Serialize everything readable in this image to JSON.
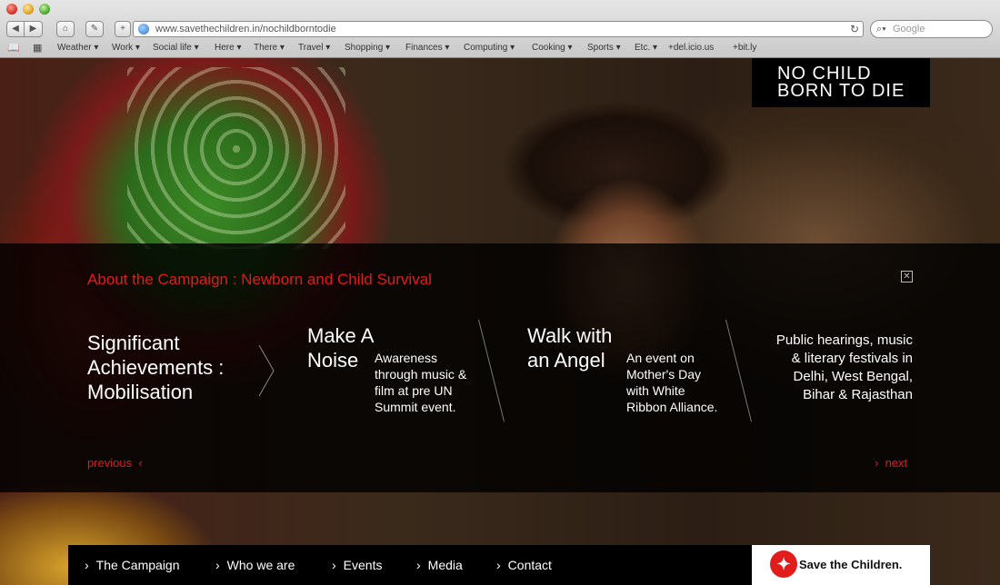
{
  "browser": {
    "url": "www.savethechildren.in/nochildborntodie",
    "search_placeholder": "Google",
    "bookmarks": [
      "Weather ▾",
      "Work ▾",
      "Social life ▾",
      "Here ▾",
      "There ▾",
      "Travel ▾",
      "Shopping ▾",
      "Finances ▾",
      "Computing ▾",
      "Cooking ▾",
      "Sports ▾",
      "Etc. ▾",
      "+del.icio.us",
      "+bit.ly"
    ]
  },
  "logo": {
    "line1": "NO CHILD",
    "line2": "BORN TO DIE"
  },
  "overlay": {
    "title": "About the Campaign : Newborn and Child Survival",
    "items": [
      {
        "heading": "Significant Achievements : Mobilisation"
      },
      {
        "heading": "Make A Noise",
        "text": "Awareness through music & film at pre UN Summit event."
      },
      {
        "heading": "Walk with an Angel",
        "text": "An event on Mother's Day with White Ribbon Alliance."
      },
      {
        "text": "Public hearings, music & literary festivals in Delhi, West Bengal, Bihar & Rajasthan"
      }
    ],
    "previous": "previous",
    "next": "next"
  },
  "footer_nav": [
    "The Campaign",
    "Who we are",
    "Events",
    "Media",
    "Contact"
  ],
  "partner": {
    "name": "Save the Children."
  },
  "colors": {
    "accent": "#e21b1b"
  }
}
